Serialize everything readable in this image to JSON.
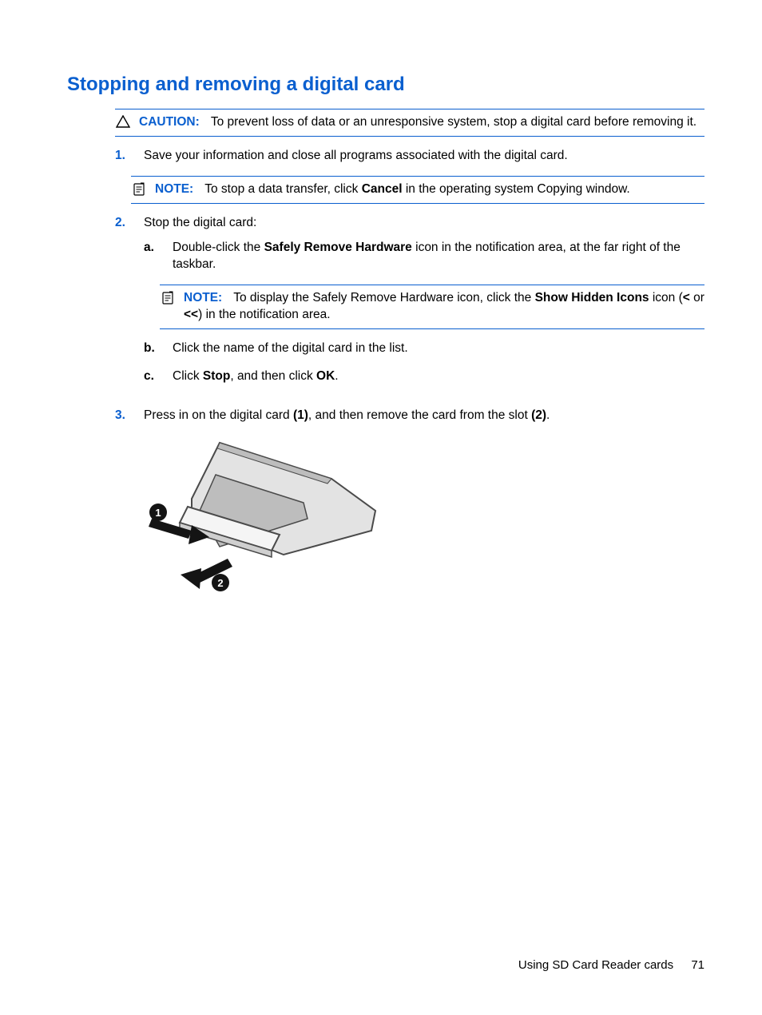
{
  "heading": "Stopping and removing a digital card",
  "caution": {
    "label": "CAUTION:",
    "text": "To prevent loss of data or an unresponsive system, stop a digital card before removing it."
  },
  "steps": {
    "s1_marker": "1.",
    "s1_text": "Save your information and close all programs associated with the digital card.",
    "note1": {
      "label": "NOTE:",
      "pre": "To stop a data transfer, click ",
      "bold": "Cancel",
      "post": " in the operating system Copying window."
    },
    "s2_marker": "2.",
    "s2_text": "Stop the digital card:",
    "sub": {
      "a_marker": "a.",
      "a_pre": "Double-click the ",
      "a_bold": "Safely Remove Hardware",
      "a_post": " icon in the notification area, at the far right of the taskbar.",
      "note2": {
        "label": "NOTE:",
        "pre": "To display the Safely Remove Hardware icon, click the ",
        "bold1": "Show Hidden Icons",
        "mid1": " icon (",
        "bold2": "<",
        "mid2": " or ",
        "bold3": "<<",
        "post": ") in the notification area."
      },
      "b_marker": "b.",
      "b_text": "Click the name of the digital card in the list.",
      "c_marker": "c.",
      "c_pre": "Click ",
      "c_bold1": "Stop",
      "c_mid": ", and then click ",
      "c_bold2": "OK",
      "c_post": "."
    },
    "s3_marker": "3.",
    "s3_pre": "Press in on the digital card ",
    "s3_bold1": "(1)",
    "s3_mid": ", and then remove the card from the slot ",
    "s3_bold2": "(2)",
    "s3_post": "."
  },
  "footer": {
    "section": "Using SD Card Reader cards",
    "page": "71"
  }
}
